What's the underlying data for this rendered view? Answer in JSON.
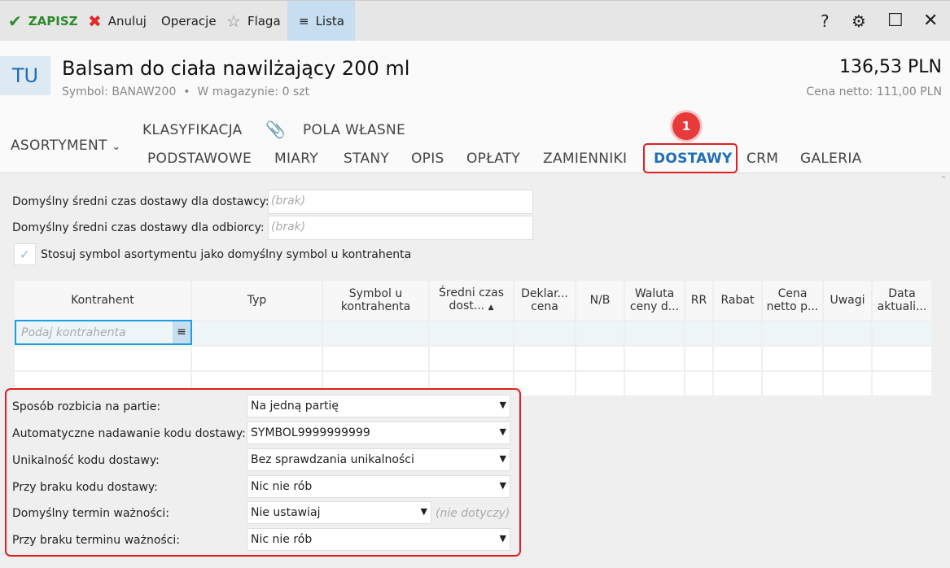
{
  "toolbar": {
    "save": "ZAPISZ",
    "cancel": "Anuluj",
    "operations": "Operacje",
    "flag": "Flaga",
    "list": "Lista"
  },
  "header": {
    "badge": "TU",
    "title": "Balsam do ciała nawilżający 200 ml",
    "symbol": "Symbol: BANAW200",
    "stock": "W magazynie: 0 szt",
    "price": "136,53 PLN",
    "net_price": "Cena netto: 111,00 PLN"
  },
  "tabs": {
    "group": "ASORTYMENT",
    "row1": [
      "KLASYFIKACJA",
      "POLA WŁASNE"
    ],
    "row2": [
      "PODSTAWOWE",
      "MIARY",
      "STANY",
      "OPIS",
      "OPŁATY",
      "ZAMIENNIKI",
      "DOSTAWY",
      "CRM",
      "GALERIA"
    ],
    "step_badge": "1"
  },
  "form": {
    "supplier_time_label": "Domyślny średni czas dostawy dla dostawcy:",
    "supplier_time_value": "(brak)",
    "customer_time_label": "Domyślny średni czas dostawy dla odbiorcy:",
    "customer_time_value": "(brak)",
    "use_symbol_label": "Stosuj symbol asortymentu jako domyślny symbol u kontrahenta"
  },
  "table": {
    "headers": [
      "Kontrahent",
      "Typ",
      "Symbol u kontrahenta",
      "Średni czas dost...",
      "Deklar... cena",
      "N/B",
      "Waluta ceny d...",
      "RR",
      "Rabat",
      "Cena netto p...",
      "Uwagi",
      "Data aktuali..."
    ],
    "placeholder": "Podaj kontrahenta"
  },
  "settings": [
    {
      "label": "Sposób rozbicia na partie:",
      "value": "Na jedną partię"
    },
    {
      "label": "Automatyczne nadawanie kodu dostawy:",
      "value": "SYMBOL9999999999"
    },
    {
      "label": "Unikalność kodu dostawy:",
      "value": "Bez sprawdzania unikalności"
    },
    {
      "label": "Przy braku kodu dostawy:",
      "value": "Nic nie rób"
    },
    {
      "label": "Domyślny termin ważności:",
      "value": "Nie ustawiaj",
      "note": "(nie dotyczy)"
    },
    {
      "label": "Przy braku terminu ważności:",
      "value": "Nic nie rób"
    }
  ]
}
